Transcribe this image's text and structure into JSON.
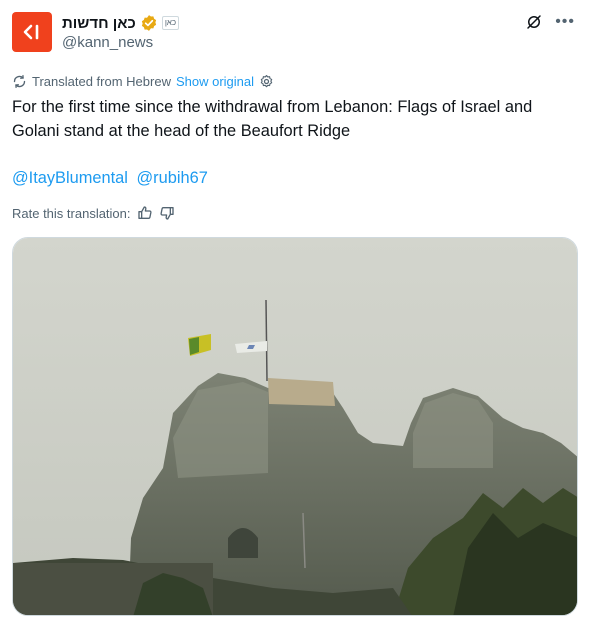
{
  "author": {
    "display_name": "כאן חדשות",
    "handle": "@kann_news",
    "affiliate_badge": "כאן",
    "avatar_glyph": "<|",
    "avatar_color": "#f0411d",
    "verified_color": "#e8a913"
  },
  "translation": {
    "translated_label": "Translated from Hebrew",
    "show_original": "Show original"
  },
  "tweet": {
    "text": "For the first time since the withdrawal from Lebanon: Flags of Israel and Golani stand at the head of the Beaufort Ridge",
    "mentions": [
      "@ItayBlumental",
      "@rubih67"
    ]
  },
  "rate": {
    "label": "Rate this translation:"
  },
  "colors": {
    "link": "#1d9bf0",
    "secondary_text": "#536471"
  },
  "icons": {
    "translate": "translate-icon",
    "settings": "gear-icon",
    "thumbs_up": "thumbs-up-icon",
    "thumbs_down": "thumbs-down-icon",
    "grok": "grok-icon",
    "more": "more-icon"
  }
}
